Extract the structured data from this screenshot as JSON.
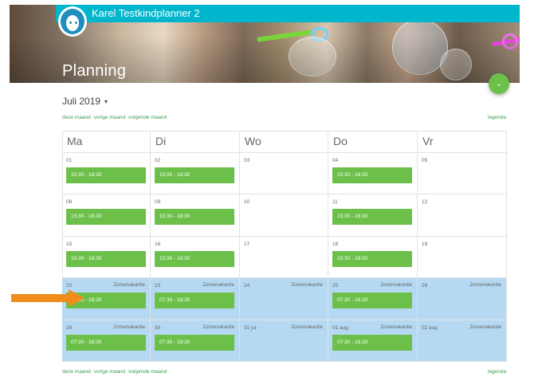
{
  "header": {
    "user_name": "Karel Testkindplanner 2",
    "page_title": "Planning"
  },
  "month_selector": {
    "label": "Juli 2019",
    "caret": "▾"
  },
  "nav": {
    "this_month": "deze maand",
    "prev_month": "vorige maand",
    "next_month": "volgende maand",
    "legend": "legenda"
  },
  "fab": {
    "icon": "chevron-down-icon",
    "glyph": "⌄"
  },
  "calendar": {
    "days": [
      "Ma",
      "Di",
      "Wo",
      "Do",
      "Vr"
    ],
    "weeks": [
      [
        {
          "date": "01",
          "slot": "15:30 - 18:30"
        },
        {
          "date": "02",
          "slot": "15:30 - 18:30"
        },
        {
          "date": "03"
        },
        {
          "date": "04",
          "slot": "15:30 - 18:30"
        },
        {
          "date": "05"
        }
      ],
      [
        {
          "date": "08",
          "slot": "15:30 - 18:30"
        },
        {
          "date": "09",
          "slot": "15:30 - 18:30"
        },
        {
          "date": "10"
        },
        {
          "date": "11",
          "slot": "15:30 - 18:30"
        },
        {
          "date": "12"
        }
      ],
      [
        {
          "date": "15",
          "slot": "15:30 - 18:30"
        },
        {
          "date": "16",
          "slot": "15:30 - 18:30"
        },
        {
          "date": "17"
        },
        {
          "date": "18",
          "slot": "15:30 - 18:30"
        },
        {
          "date": "19"
        }
      ],
      [
        {
          "date": "22",
          "note": "Zomervakantie",
          "slot": "07:30 - 18:30"
        },
        {
          "date": "23",
          "note": "Zomervakantie",
          "slot": "07:30 - 18:30"
        },
        {
          "date": "24",
          "note": "Zomervakantie"
        },
        {
          "date": "25",
          "note": "Zomervakantie",
          "slot": "07:30 - 18:30"
        },
        {
          "date": "26",
          "note": "Zomervakantie"
        }
      ],
      [
        {
          "date": "29",
          "note": "Zomervakantie",
          "slot": "07:30 - 18:30"
        },
        {
          "date": "30",
          "note": "Zomervakantie",
          "slot": "07:30 - 18:30"
        },
        {
          "date": "31 jul",
          "note": "Zomervakantie"
        },
        {
          "date": "01 aug",
          "note": "Zomervakantie",
          "slot": "07:30 - 18:30"
        },
        {
          "date": "02 aug",
          "note": "Zomervakantie"
        }
      ]
    ]
  },
  "colors": {
    "topbar": "#00b6cc",
    "slot": "#6cc04a",
    "vacation": "#b5d9f2",
    "arrow": "#f08c1a",
    "link": "#3aa052"
  }
}
